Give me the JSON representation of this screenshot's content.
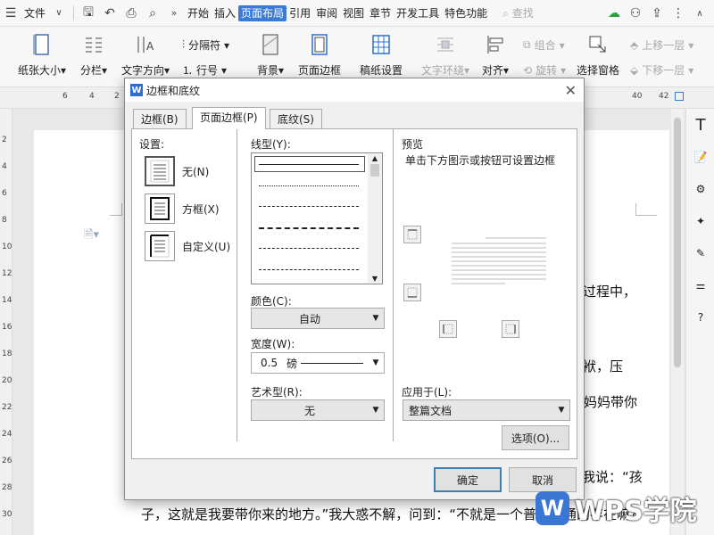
{
  "menubar": {
    "file_label": "文件",
    "items": [
      "开始",
      "插入",
      "页面布局",
      "引用",
      "审阅",
      "视图",
      "章节",
      "开发工具",
      "特色功能"
    ],
    "active_index": 2,
    "search_placeholder": "查找"
  },
  "ribbon": {
    "paper_size": "纸张大小",
    "columns": "分栏",
    "text_direction": "文字方向",
    "separator": "分隔符",
    "line_number": "行号",
    "background": "背景",
    "page_border": "页面边框",
    "manuscript": "稿纸设置",
    "text_wrap": "文字环绕",
    "align": "对齐",
    "group": "组合",
    "rotate": "旋转",
    "selection_pane": "选择窗格",
    "bring_forward": "上移一层",
    "send_backward": "下移一层"
  },
  "ruler": {
    "ticks": [
      "6",
      "4",
      "2",
      "40",
      "42"
    ]
  },
  "vruler": {
    "ticks": [
      "2",
      "4",
      "6",
      "8",
      "10",
      "12",
      "14",
      "16",
      "18",
      "20",
      "22",
      "24",
      "26",
      "28",
      "30"
    ]
  },
  "document": {
    "line1": "个过程中，",
    "line2": "包袱，压",
    "line3": "妈妈带你",
    "line4": "我说：“孩",
    "line5": "子，这就是我要带你来的地方。”我大惑不解，问到：“不就是一个普普通通的存在嘛？"
  },
  "dialog": {
    "title": "边框和底纹",
    "tabs": [
      "边框(B)",
      "页面边框(P)",
      "底纹(S)"
    ],
    "selected_tab": 1,
    "settings_label": "设置:",
    "settings": [
      "无(N)",
      "方框(X)",
      "自定义(U)"
    ],
    "line_style_label": "线型(Y):",
    "color_label": "颜色(C):",
    "color_value": "自动",
    "width_label": "宽度(W):",
    "width_value": "0.5",
    "width_unit": "磅",
    "art_label": "艺术型(R):",
    "art_value": "无",
    "preview_label": "预览",
    "preview_hint": "单击下方图示或按钮可设置边框",
    "apply_label": "应用于(L):",
    "apply_value": "整篇文档",
    "options_button": "选项(O)...",
    "ok_button": "确定",
    "cancel_button": "取消"
  },
  "watermark": {
    "text": "WPS学院",
    "logo": "W"
  },
  "colors": {
    "accent": "#3a7bd5"
  }
}
